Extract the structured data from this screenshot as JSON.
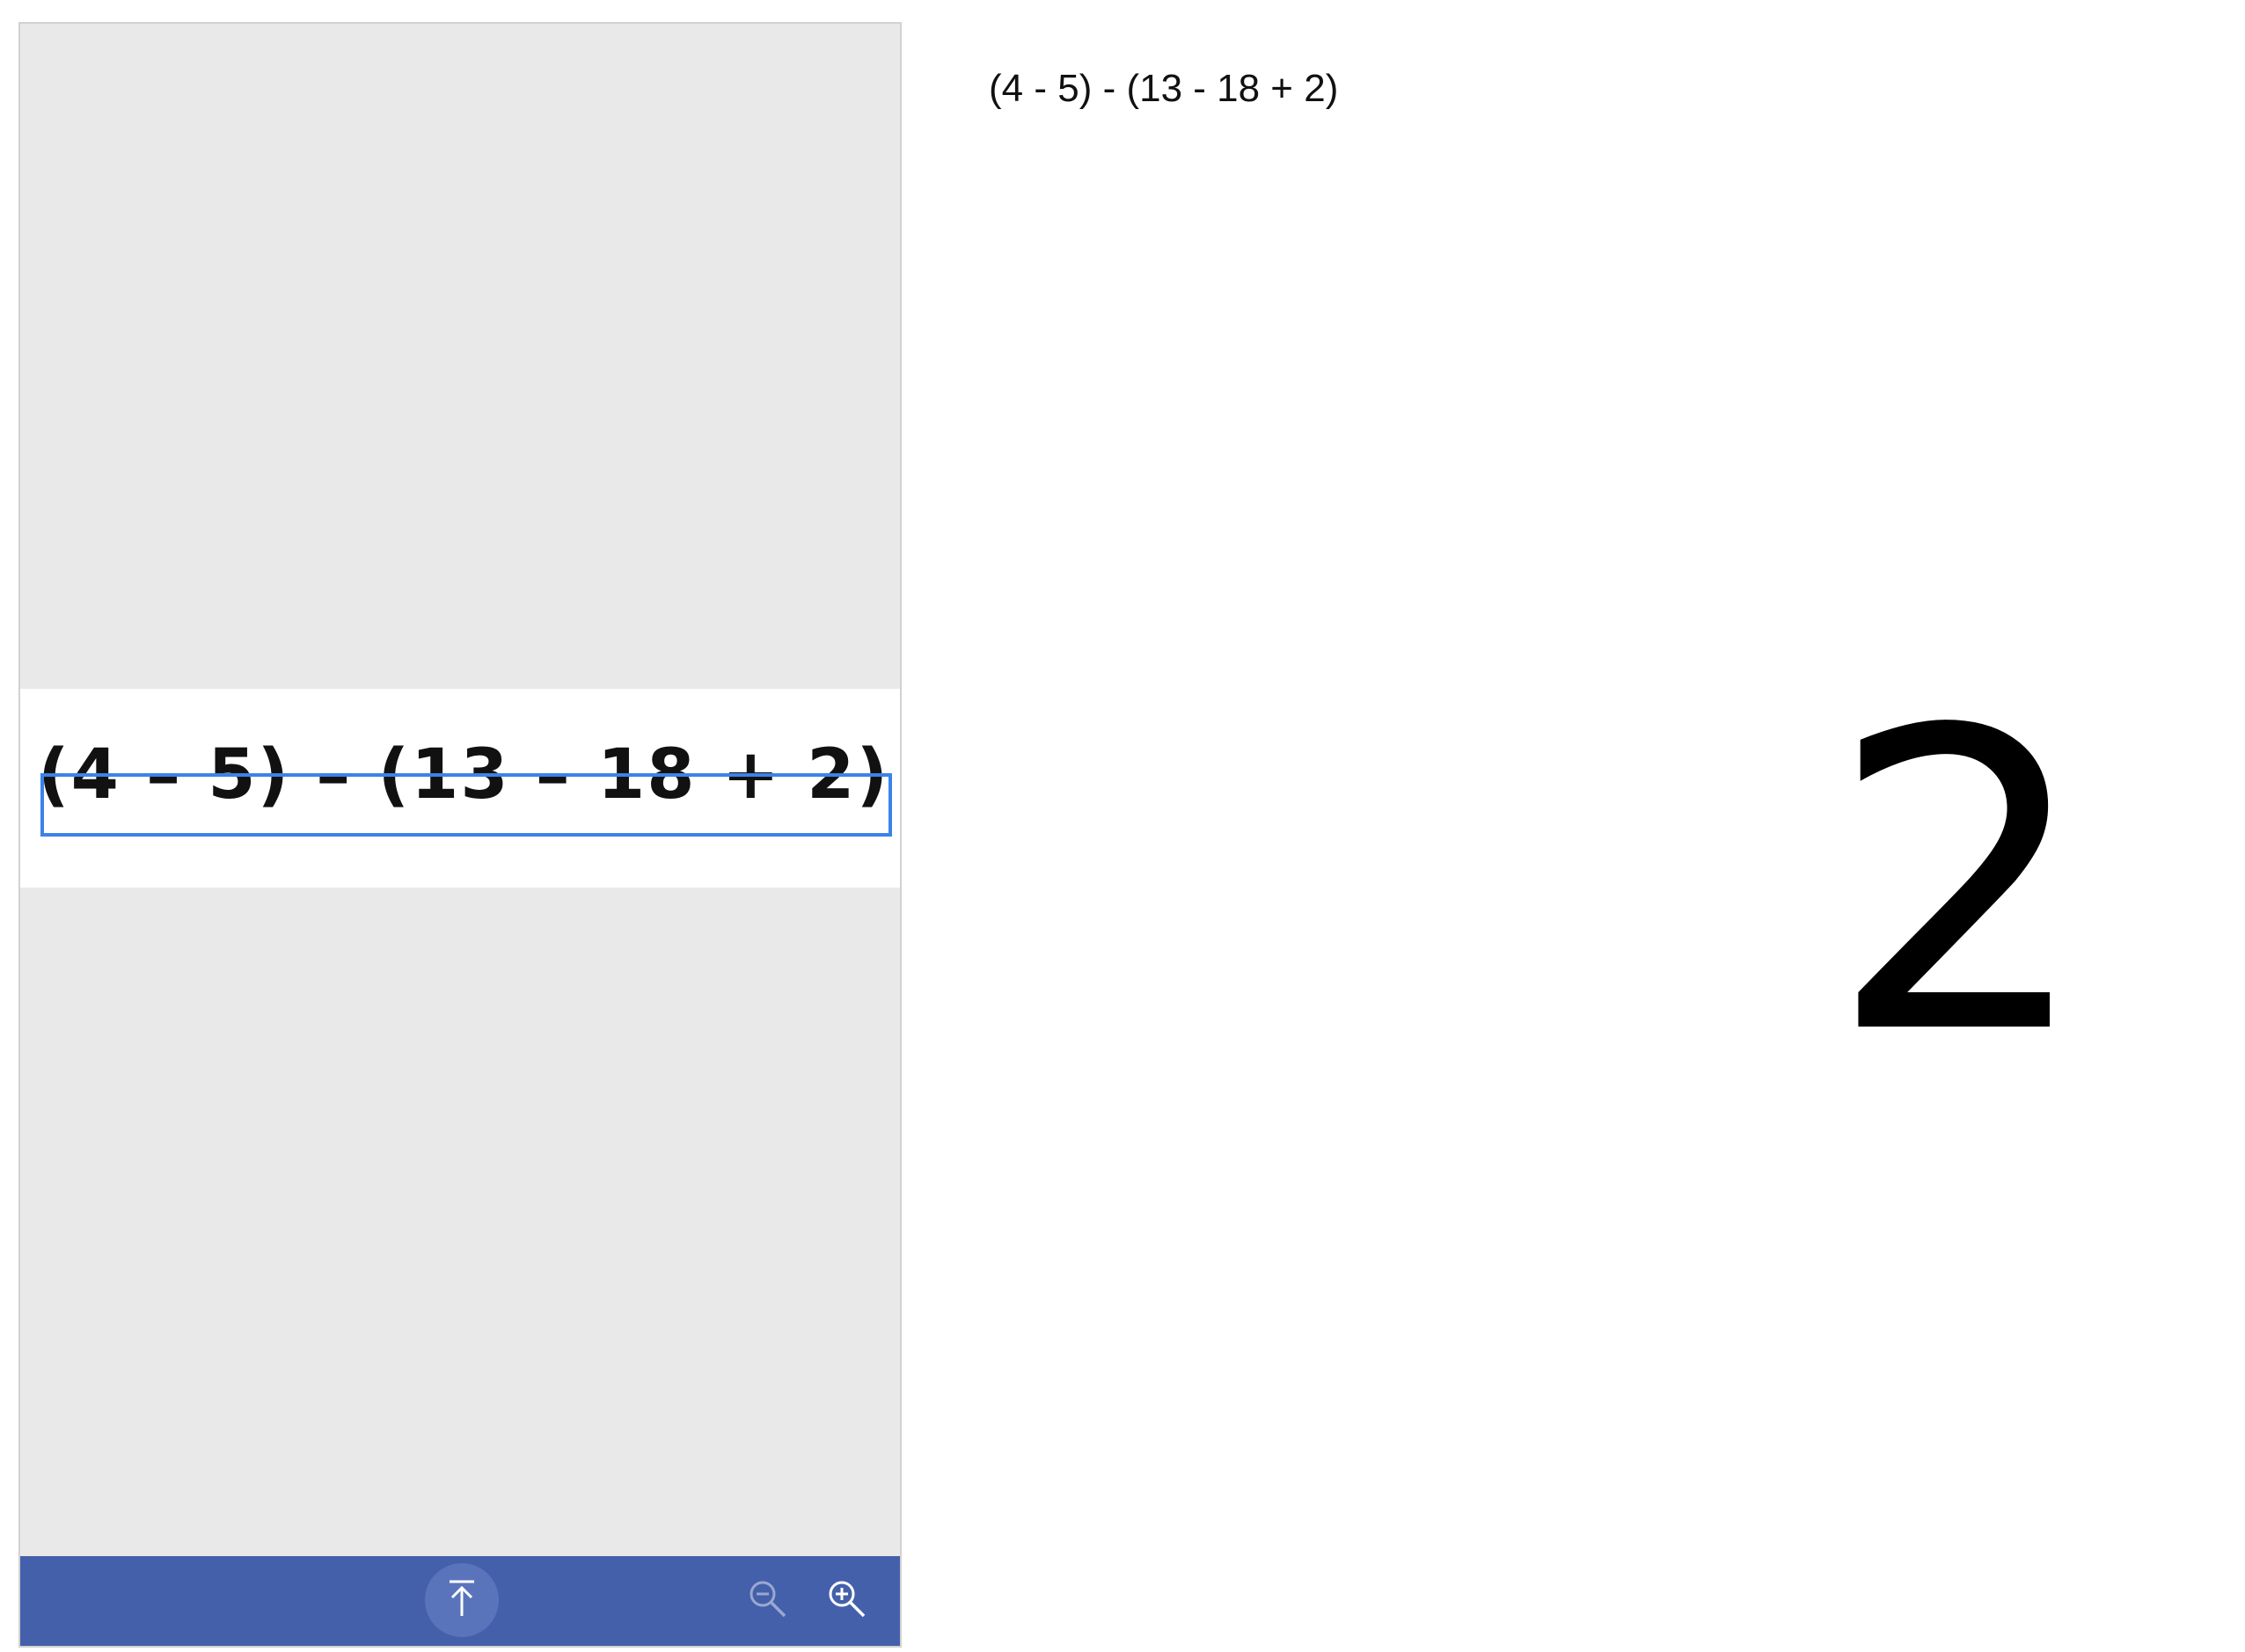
{
  "viewer": {
    "document_expression": "(4 – 5) – (13 – 18 + 2)",
    "background_color": "#e9e9e9",
    "selection_color": "#3b83e8"
  },
  "toolbar": {
    "background_color": "#4560aa",
    "scroll_top_icon": "arrow-up-to-line-icon",
    "zoom_out_icon": "zoom-out-icon",
    "zoom_in_icon": "zoom-in-icon"
  },
  "recognized_expression": "(4 - 5) - (13 - 18 + 2)",
  "answer": "2"
}
